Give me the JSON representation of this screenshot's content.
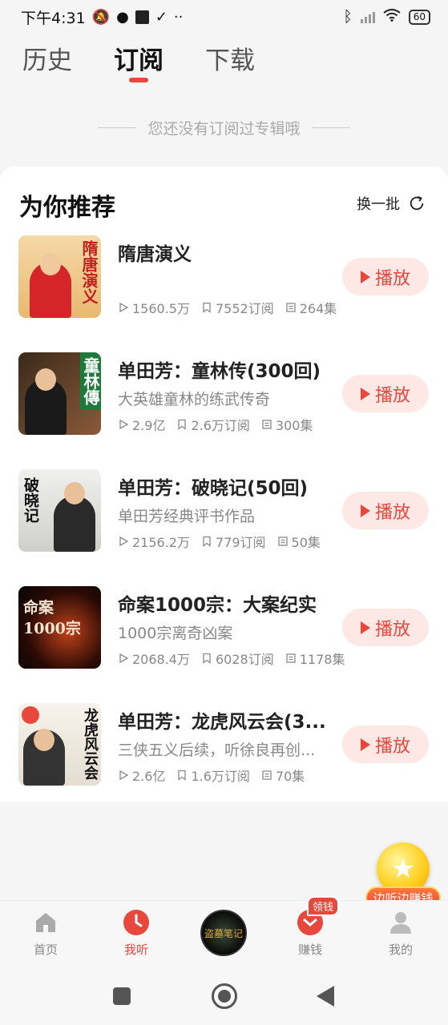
{
  "status_bar": {
    "time": "下午4:31",
    "battery": "60"
  },
  "top_tabs": [
    {
      "label": "历史",
      "active": false
    },
    {
      "label": "订阅",
      "active": true
    },
    {
      "label": "下载",
      "active": false
    }
  ],
  "empty_notice": "您还没有订阅过专辑哦",
  "recommend": {
    "title": "为你推荐",
    "refresh_label": "换一批",
    "play_label": "播放",
    "albums": [
      {
        "name": "隋唐演义",
        "desc": "",
        "plays": "1560.5万",
        "subs": "7552订阅",
        "episodes": "264集",
        "cover_text": "隋唐演义"
      },
      {
        "name": "单田芳：童林传(300回)",
        "desc": "大英雄童林的练武传奇",
        "plays": "2.9亿",
        "subs": "2.6万订阅",
        "episodes": "300集",
        "cover_text": "童林傳"
      },
      {
        "name": "单田芳：破晓记(50回)",
        "desc": "单田芳经典评书作品",
        "plays": "2156.2万",
        "subs": "779订阅",
        "episodes": "50集",
        "cover_text": "破晓记"
      },
      {
        "name": "命案1000宗：大案纪实",
        "desc": "1000宗离奇凶案",
        "plays": "2068.4万",
        "subs": "6028订阅",
        "episodes": "1178集",
        "cover_text": "命案1000宗"
      },
      {
        "name": "单田芳：龙虎风云会(3...",
        "desc": "三侠五义后续，听徐良再创...",
        "plays": "2.6亿",
        "subs": "1.6万订阅",
        "episodes": "70集",
        "cover_text": "龙虎风云会"
      }
    ]
  },
  "floating": {
    "label": "边听边赚钱"
  },
  "bottom_nav": {
    "items": [
      {
        "label": "首页"
      },
      {
        "label": "我听"
      },
      {
        "label": "赚钱"
      },
      {
        "label": "我的"
      }
    ],
    "earn_badge": "领钱",
    "center_disc_text": "盗墓笔记"
  },
  "colors": {
    "accent": "#e8473c",
    "play_bg": "#fde8e6"
  }
}
